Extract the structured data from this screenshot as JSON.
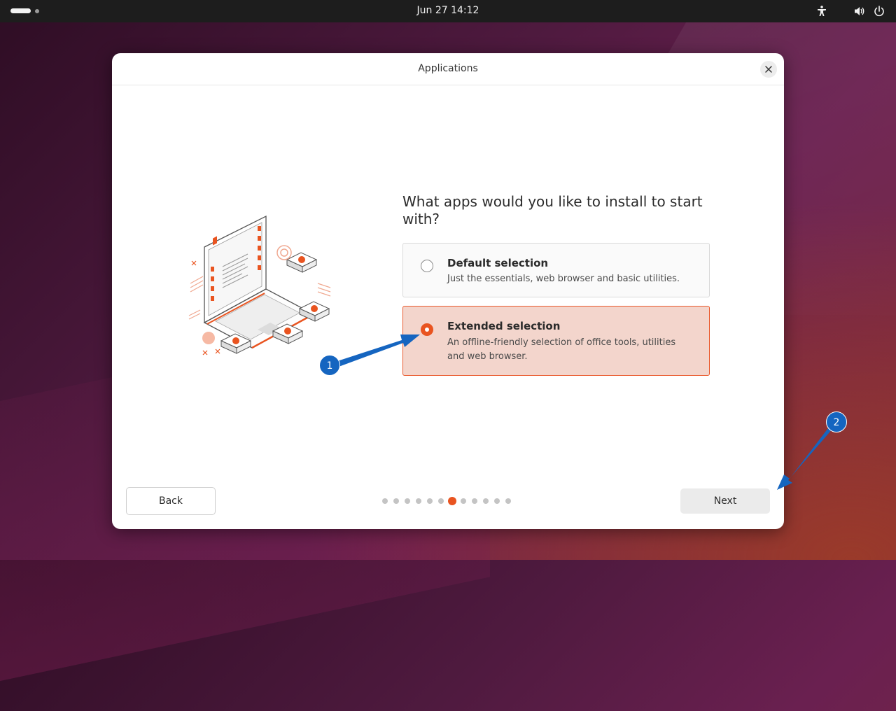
{
  "topbar": {
    "clock": "Jun 27  14:12",
    "icons": [
      "accessibility-icon",
      "volume-icon",
      "power-icon"
    ]
  },
  "dialog": {
    "title": "Applications",
    "question": "What apps would you like to install to start with?",
    "options": [
      {
        "title": "Default selection",
        "description": "Just the essentials, web browser and basic utilities.",
        "selected": false
      },
      {
        "title": "Extended selection",
        "description": "An offline-friendly selection of office tools, utilities and web browser.",
        "selected": true
      }
    ],
    "back_label": "Back",
    "next_label": "Next",
    "pager": {
      "total": 12,
      "current": 7
    }
  },
  "annotations": [
    {
      "label": "1"
    },
    {
      "label": "2"
    }
  ],
  "colors": {
    "accent": "#e95420",
    "selected_bg": "#f3d5cc",
    "annotation": "#1565c0"
  }
}
